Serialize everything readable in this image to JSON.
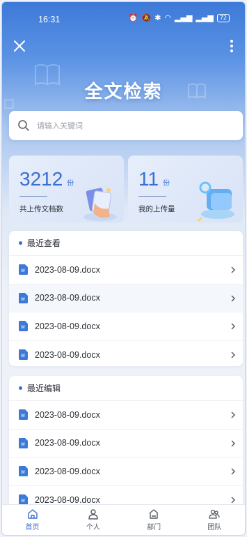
{
  "status_bar": {
    "time": "16:31",
    "battery": "72"
  },
  "header": {
    "title": "全文检索"
  },
  "search": {
    "placeholder": "请输入关键词"
  },
  "stats": {
    "total": {
      "value": "3212",
      "unit": "份",
      "label": "共上传文档数"
    },
    "mine": {
      "value": "11",
      "unit": "份",
      "label": "我的上传量"
    }
  },
  "recent_view": {
    "title": "最近查看",
    "files": [
      {
        "name": "2023-08-09.docx"
      },
      {
        "name": "2023-08-09.docx"
      },
      {
        "name": "2023-08-09.docx"
      },
      {
        "name": "2023-08-09.docx"
      }
    ]
  },
  "recent_edit": {
    "title": "最近编辑",
    "files": [
      {
        "name": "2023-08-09.docx"
      },
      {
        "name": "2023-08-09.docx"
      },
      {
        "name": "2023-08-09.docx"
      },
      {
        "name": "2023-08-09.docx"
      }
    ]
  },
  "tabbar": {
    "items": [
      {
        "label": "首页",
        "icon": "home-icon",
        "active": true
      },
      {
        "label": "个人",
        "icon": "person-icon",
        "active": false
      },
      {
        "label": "部门",
        "icon": "department-icon",
        "active": false
      },
      {
        "label": "团队",
        "icon": "team-icon",
        "active": false
      }
    ]
  },
  "colors": {
    "accent": "#3a6fd4",
    "header_top": "#3d7ad8",
    "background": "#eef2f8"
  }
}
